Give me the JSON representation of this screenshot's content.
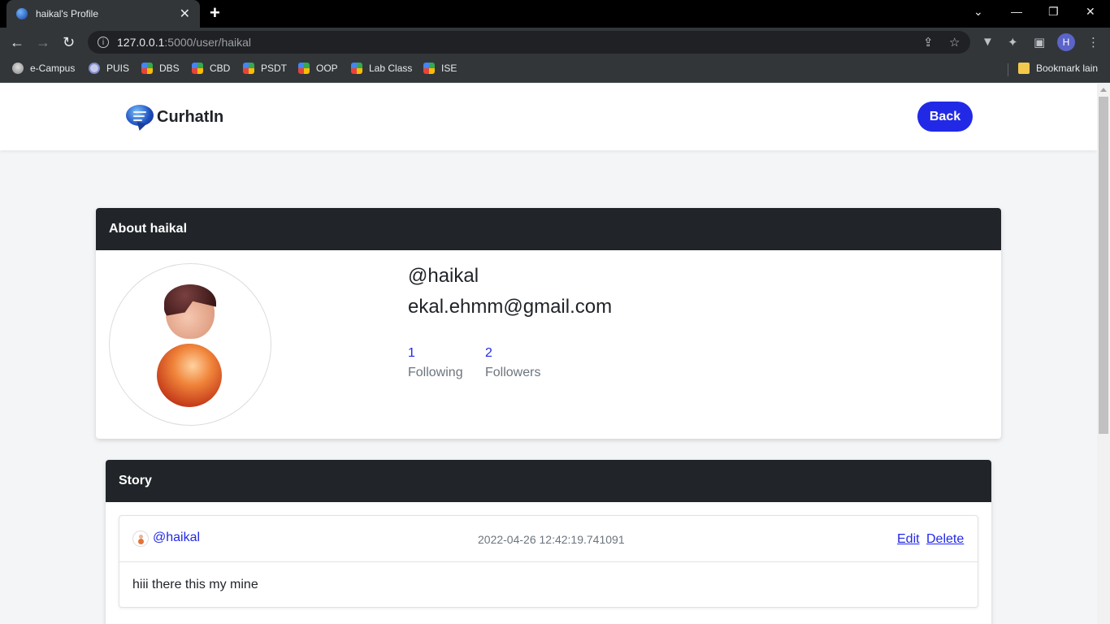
{
  "browser": {
    "tab_title": "haikal's Profile",
    "url_host": "127.0.0.1",
    "url_path": ":5000/user/haikal",
    "profile_initial": "H",
    "bookmarks": [
      {
        "label": "e-Campus",
        "icon": "campus-icon"
      },
      {
        "label": "PUIS",
        "icon": "puis-icon"
      },
      {
        "label": "DBS",
        "icon": "meet-icon"
      },
      {
        "label": "CBD",
        "icon": "meet-icon"
      },
      {
        "label": "PSDT",
        "icon": "meet-icon"
      },
      {
        "label": "OOP",
        "icon": "meet-icon"
      },
      {
        "label": "Lab Class",
        "icon": "meet-icon"
      },
      {
        "label": "ISE",
        "icon": "meet-icon"
      }
    ],
    "other_bookmarks": "Bookmark lain"
  },
  "navbar": {
    "brand": "CurhatIn",
    "back_label": "Back"
  },
  "about": {
    "header": "About haikal",
    "username": "@haikal",
    "email": "ekal.ehmm@gmail.com",
    "following_count": "1",
    "following_label": "Following",
    "followers_count": "2",
    "followers_label": "Followers"
  },
  "story": {
    "header": "Story",
    "posts": [
      {
        "user": "@haikal",
        "timestamp": "2022-04-26 12:42:19.741091",
        "edit_label": "Edit",
        "delete_label": "Delete",
        "content": "hiii there this my mine"
      }
    ]
  },
  "colors": {
    "accent": "#2229e6",
    "card_header": "#212529"
  }
}
